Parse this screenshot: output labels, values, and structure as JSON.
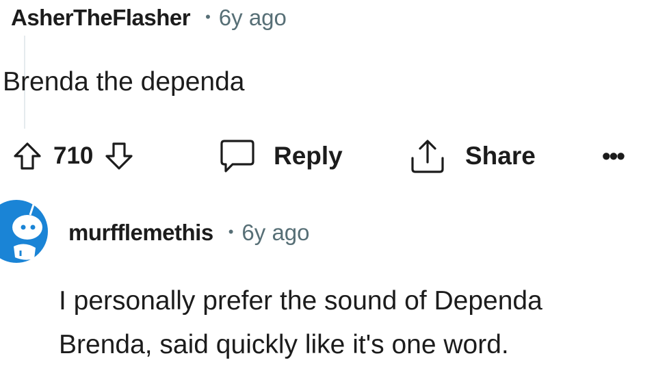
{
  "comment_1": {
    "author": "AsherTheFlasher",
    "separator": "•",
    "timestamp": "6y ago",
    "body": "Brenda the dependa"
  },
  "actions": {
    "upvote_icon": "arrow-up-outline-icon",
    "vote_count": "710",
    "downvote_icon": "arrow-down-outline-icon",
    "reply_icon": "speech-bubble-icon",
    "reply_label": "Reply",
    "share_icon": "share-upload-icon",
    "share_label": "Share",
    "more_label": "•••"
  },
  "comment_2": {
    "author": "murfflemethis",
    "separator": "•",
    "timestamp": "6y ago",
    "body_line_1": "I personally prefer the sound of Dependa",
    "body_line_2": "Brenda, said quickly like it's one word."
  },
  "colors": {
    "text": "#1c1c1c",
    "meta": "#576f76",
    "avatar_blue": "#1a84d6",
    "thread_line": "#e5ebee"
  }
}
